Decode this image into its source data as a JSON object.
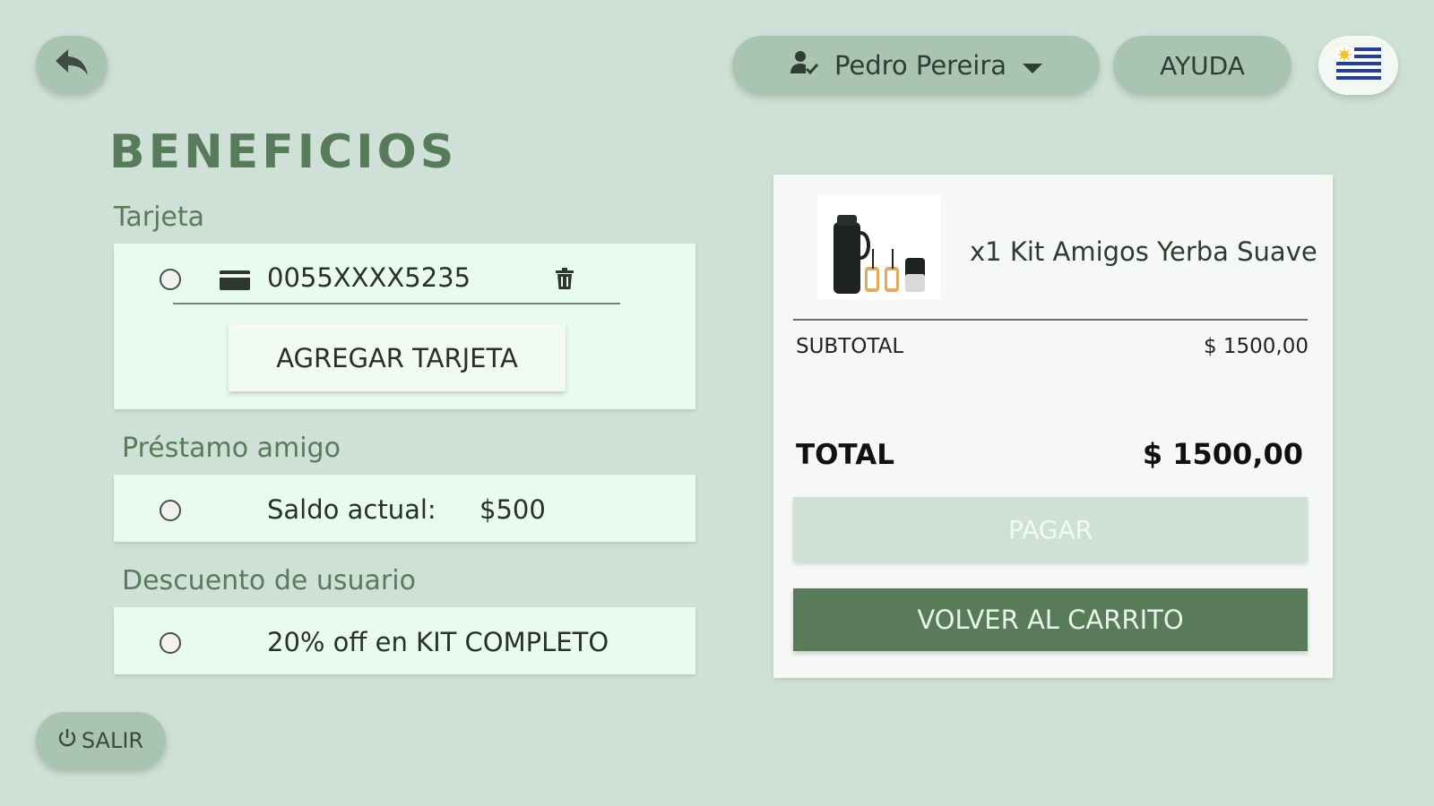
{
  "header": {
    "user_name": "Pedro Pereira",
    "help_label": "AYUDA",
    "language_flag": "uruguay-flag-icon"
  },
  "page": {
    "title": "BENEFICIOS"
  },
  "card_section": {
    "label": "Tarjeta",
    "saved_card_number": "0055XXXX5235",
    "add_card_label": "AGREGAR TARJETA"
  },
  "loan_section": {
    "label": "Préstamo amigo",
    "balance_label": "Saldo actual:",
    "balance_value": "$500"
  },
  "discount_section": {
    "label": "Descuento de usuario",
    "discount_text": "20% off en KIT COMPLETO"
  },
  "summary": {
    "product_name": "x1 Kit Amigos Yerba Suave",
    "subtotal_label": "SUBTOTAL",
    "subtotal_value": "$ 1500,00",
    "total_label": "TOTAL",
    "total_value": "$ 1500,00",
    "pay_label": "PAGAR",
    "back_to_cart_label": "VOLVER AL CARRITO"
  },
  "footer": {
    "exit_label": "SALIR"
  },
  "colors": {
    "background": "#cfe1d6",
    "accent_green": "#587b5b",
    "button_green": "#a9c4b1",
    "card_bg": "#e9fbef"
  }
}
